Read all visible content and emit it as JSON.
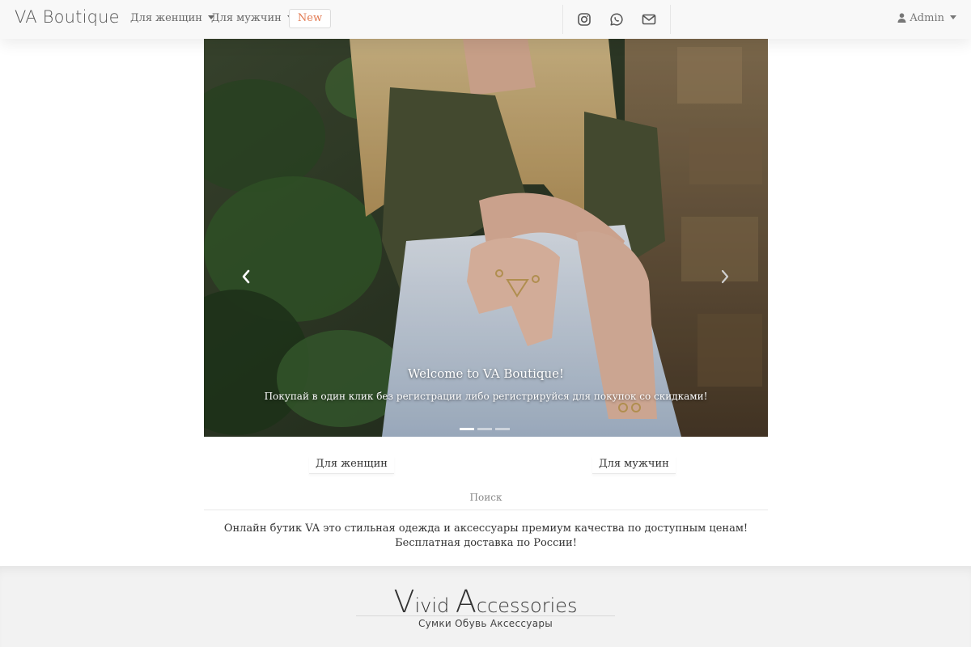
{
  "navbar": {
    "brand": "VA Boutique",
    "menu_women": "Для женщин",
    "menu_men": "Для мужчин",
    "new_label": "New",
    "social_icons": [
      "instagram-icon",
      "whatsapp-icon",
      "mail-icon"
    ],
    "user_label": "Admin"
  },
  "carousel": {
    "caption_title": "Welcome to VA Boutique!",
    "caption_text": "Покупай в один клик без регистрации либо регистрируйся для покупок со скидками!",
    "slide_count": 3,
    "active_slide": 1
  },
  "categories": {
    "women": "Для женщин",
    "men": "Для мужчин"
  },
  "search_label": "Поиск",
  "description": "Онлайн бутик VA это стильная одежда и аксессуары премиум качества по доступным ценам! Бесплатная доставка по России!",
  "footer": {
    "logo_v": "V",
    "logo_ivid": "ivid ",
    "logo_a": "A",
    "logo_ccessories": "ccessories",
    "tagline": "Сумки Обувь Аксессуары"
  },
  "colors": {
    "accent": "#e27a52",
    "navbar_bg": "#f8f8f8",
    "footer_bg": "#f2f2f2"
  }
}
